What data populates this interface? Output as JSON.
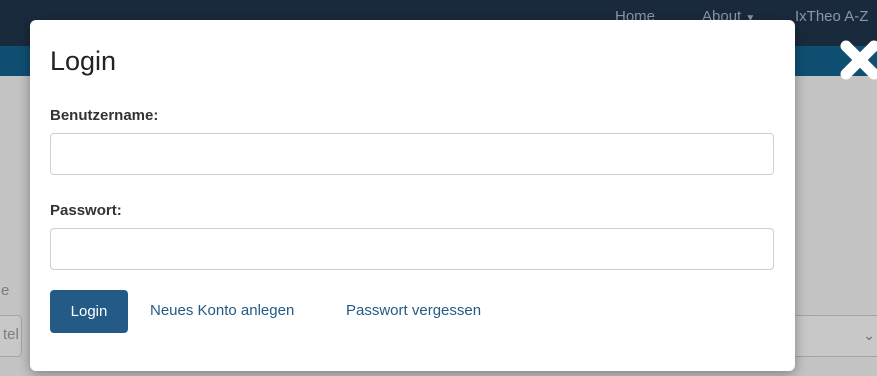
{
  "background": {
    "nav": {
      "home": "Home",
      "about": "About",
      "about_caret": "▼",
      "ixtheo": "IxTheo A-Z"
    },
    "fragment_left_1": "e",
    "fragment_left_2": "tel",
    "select_chevron": "⌄"
  },
  "modal": {
    "title": "Login",
    "username_label": "Benutzername:",
    "username_value": "",
    "password_label": "Passwort:",
    "password_value": "",
    "login_button": "Login",
    "new_account_link": "Neues Konto anlegen",
    "forgot_password_link": "Passwort vergessen"
  },
  "colors": {
    "primary": "#235a86",
    "nav_bg": "#1a2a3d",
    "band_bg": "#0f4f72",
    "overlay_bg": "#c4c4c4"
  },
  "icons": {
    "close": "close-icon"
  }
}
